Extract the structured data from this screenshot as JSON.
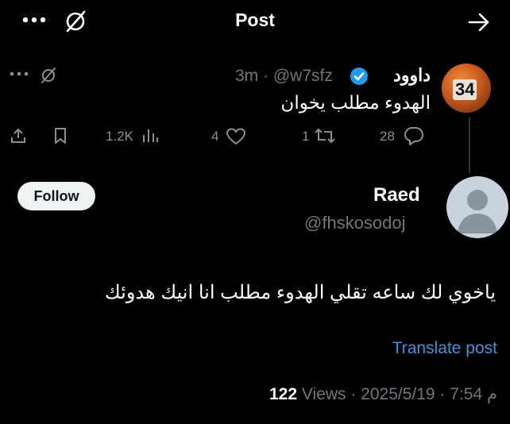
{
  "header": {
    "title": "Post"
  },
  "parent_post": {
    "display_name": "داوود",
    "handle_time": "3m · @w7sfz",
    "text": "الهدوء مطلب يخوان",
    "avatar_number": "34",
    "views": "1.2K",
    "likes": "4",
    "reposts": "1",
    "replies": "28"
  },
  "reply": {
    "display_name": "Raed",
    "handle": "@fhskosodoj",
    "follow_label": "Follow",
    "text": "ياخوي لك ساعه تقلي الهدوء مطلب انا انيك هدوئك",
    "translate_label": "Translate post",
    "views_count": "122",
    "views_label": " Views",
    "meta": " · م 7:54 · 2025/5/19"
  },
  "colors": {
    "background": "#000000",
    "link": "#4a90d9",
    "verified": "#1d9bf0",
    "text_secondary": "#71767b"
  }
}
